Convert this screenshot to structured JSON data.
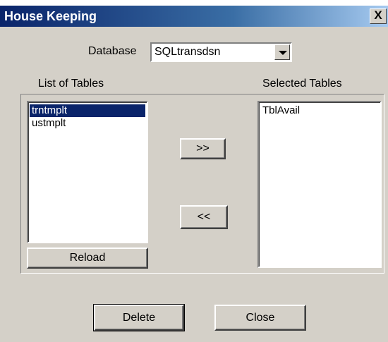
{
  "window": {
    "title": "House Keeping",
    "close_label": "X"
  },
  "database": {
    "label": "Database",
    "value": "SQLtransdsn"
  },
  "tables": {
    "list_label": "List of Tables",
    "list_items": [
      {
        "label": "trntmplt",
        "selected": true
      },
      {
        "label": "ustmplt",
        "selected": false
      }
    ],
    "selected_label": "Selected Tables",
    "selected_items": [
      {
        "label": "TblAvail"
      }
    ]
  },
  "buttons": {
    "add": ">>",
    "remove": "<<",
    "reload": "Reload",
    "delete": "Delete",
    "close": "Close"
  },
  "colors": {
    "titlebar_start": "#0a246a",
    "titlebar_end": "#a6caf0",
    "face": "#d4d0c8",
    "selection": "#0a246a"
  }
}
